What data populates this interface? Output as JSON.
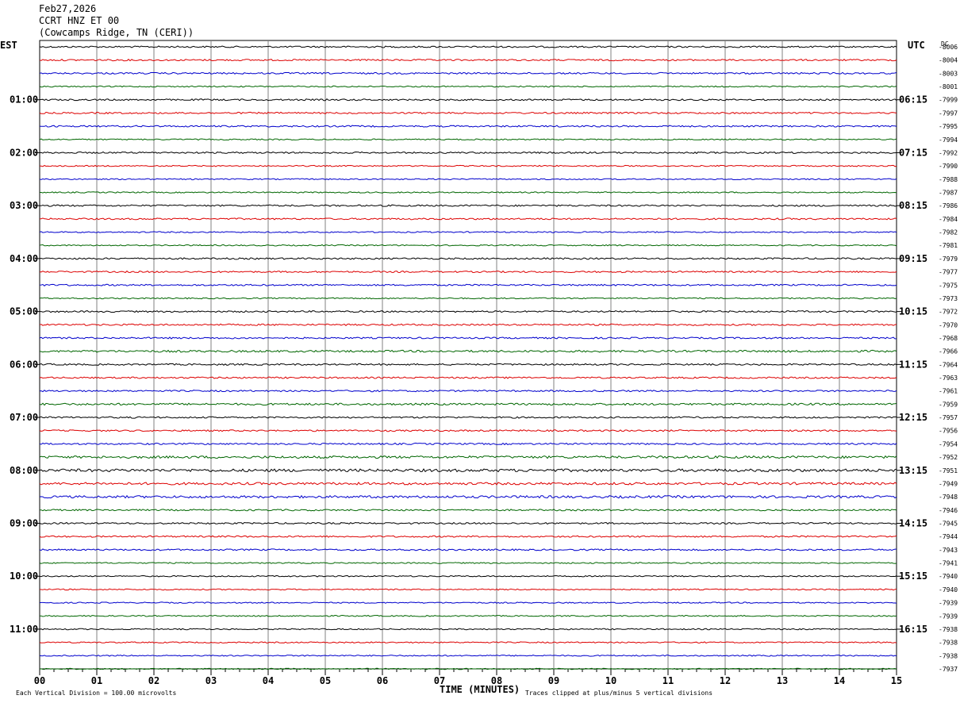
{
  "header": {
    "date": "Feb27,2026",
    "station": "CCRT HNZ ET 00",
    "location": "(Cowcamps Ridge, TN (CERI))"
  },
  "chart_data": {
    "type": "line",
    "left_axis_label": "EST",
    "right_axis_label": "UTC",
    "dc_label": "DC",
    "xlabel": "TIME (MINUTES)",
    "xlim": [
      0,
      15
    ],
    "x_tick_labels": [
      "00",
      "01",
      "02",
      "03",
      "04",
      "05",
      "06",
      "07",
      "08",
      "09",
      "10",
      "11",
      "12",
      "13",
      "14",
      "15"
    ],
    "row_minutes": 15,
    "trace_colors": [
      "#000000",
      "#dd0000",
      "#0000cc",
      "#006600"
    ],
    "est_hour_labels": [
      "01:00",
      "02:00",
      "03:00",
      "04:00",
      "05:00",
      "06:00",
      "07:00",
      "08:00",
      "09:00",
      "10:00",
      "11:00"
    ],
    "utc_hour_labels": [
      "06:15",
      "07:15",
      "08:15",
      "09:15",
      "10:15",
      "11:15",
      "12:15",
      "13:15",
      "14:15",
      "15:15",
      "16:15"
    ],
    "dc_offsets": [
      "-8006",
      "-8004",
      "-8003",
      "-8001",
      "-7999",
      "-7997",
      "-7995",
      "-7994",
      "-7992",
      "-7990",
      "-7988",
      "-7987",
      "-7986",
      "-7984",
      "-7982",
      "-7981",
      "-7979",
      "-7977",
      "-7975",
      "-7973",
      "-7972",
      "-7970",
      "-7968",
      "-7966",
      "-7964",
      "-7963",
      "-7961",
      "-7959",
      "-7957",
      "-7956",
      "-7954",
      "-7952",
      "-7951",
      "-7949",
      "-7948",
      "-7946",
      "-7945",
      "-7944",
      "-7943",
      "-7941",
      "-7940",
      "-7940",
      "-7939",
      "-7939",
      "-7938",
      "-7938",
      "-7938",
      "-7937"
    ],
    "noise_level": [
      2,
      2,
      2,
      1.5,
      2,
      2,
      2,
      1.5,
      2,
      1.5,
      1.5,
      1.5,
      2,
      2,
      1.5,
      1.5,
      2,
      2,
      2,
      1.5,
      2,
      2,
      2,
      2.5,
      2,
      2,
      2,
      2.5,
      2,
      2,
      2,
      3,
      3.5,
      3,
      3,
      2,
      2,
      2,
      2,
      1.5,
      1.5,
      1.5,
      1.5,
      1.5,
      1.5,
      1.5,
      1.5,
      1.5
    ],
    "footer_left": "Each Vertical Division =  100.00 microvolts",
    "footer_right": "Traces clipped at plus/minus 5 vertical divisions"
  }
}
